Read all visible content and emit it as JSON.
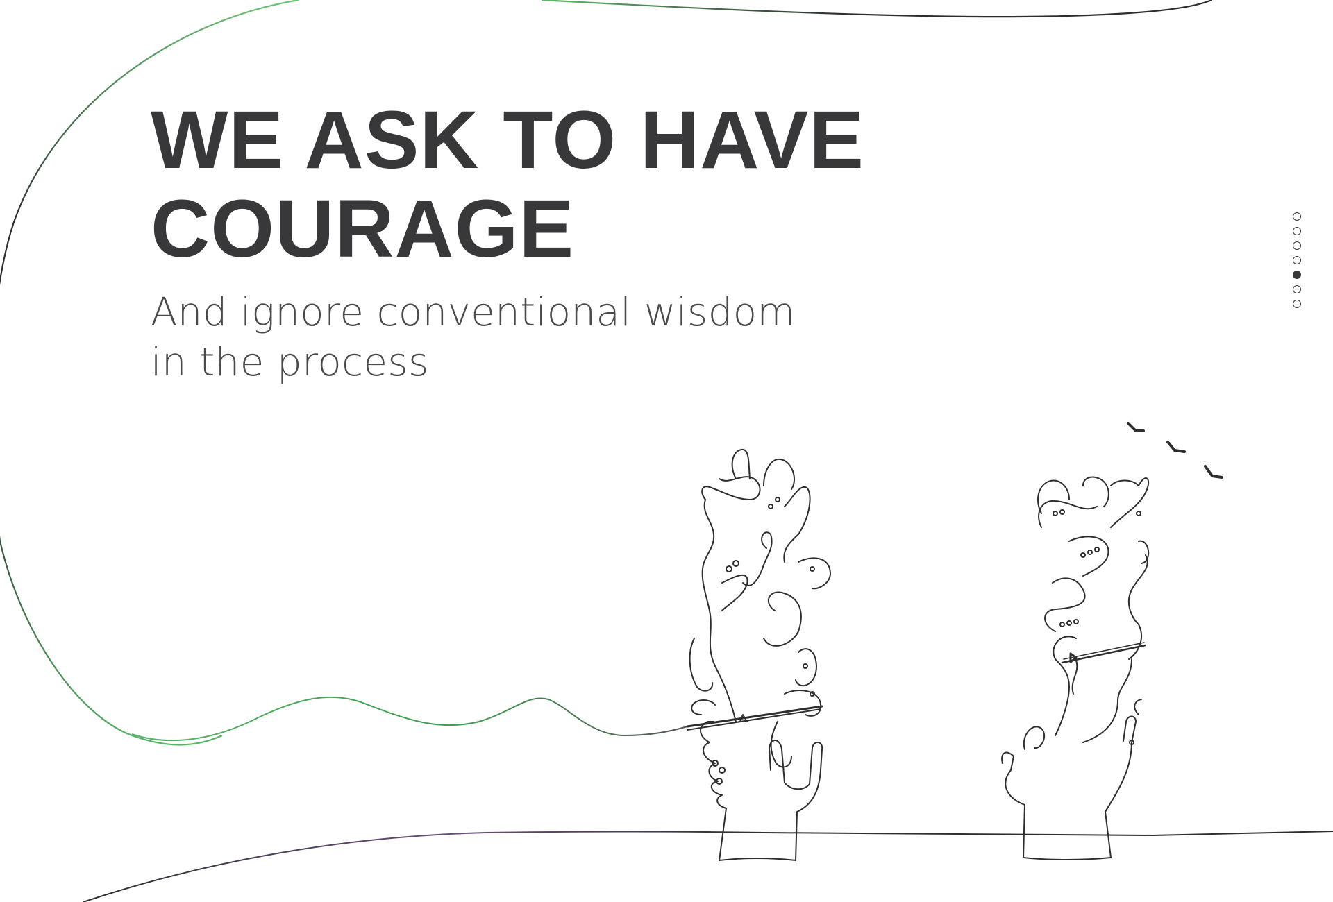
{
  "hero": {
    "title_line_1": "WE ASK TO HAVE",
    "title_line_2": "COURAGE",
    "subtitle_line_1": "And ignore conventional wisdom",
    "subtitle_line_2": "in the process"
  },
  "pagination": {
    "total": 7,
    "active_index": 4,
    "dots": [
      {
        "label": "slide-1",
        "active": false
      },
      {
        "label": "slide-2",
        "active": false
      },
      {
        "label": "slide-3",
        "active": false
      },
      {
        "label": "slide-4",
        "active": false
      },
      {
        "label": "slide-5",
        "active": true
      },
      {
        "label": "slide-6",
        "active": false
      },
      {
        "label": "slide-7",
        "active": false
      }
    ]
  },
  "illustration": {
    "subject": "two-hand-drawn-raised-hands-tied-with-rope",
    "birds": 3
  },
  "colors": {
    "text_dark": "#38383a",
    "accent_green": "#5fb86b",
    "accent_purple": "#6a4e7a",
    "line_dark": "#2e2e30",
    "background": "#ffffff"
  }
}
